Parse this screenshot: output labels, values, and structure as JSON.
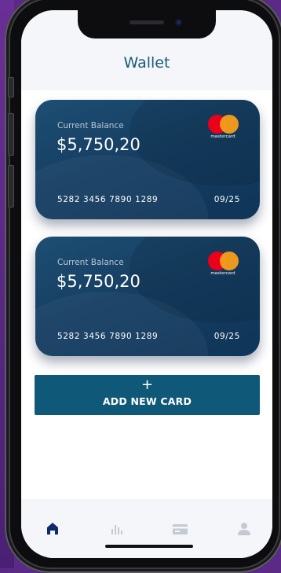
{
  "header": {
    "title": "Wallet"
  },
  "cards": [
    {
      "balance_label": "Current Balance",
      "balance": "$5,750,20",
      "number": "5282 3456 7890 1289",
      "expiry": "09/25",
      "brand": "mastercard"
    },
    {
      "balance_label": "Current Balance",
      "balance": "$5,750,20",
      "number": "5282 3456 7890 1289",
      "expiry": "09/25",
      "brand": "mastercard"
    }
  ],
  "add_card": {
    "icon": "+",
    "label": "ADD NEW CARD"
  },
  "tabbar": {
    "items": [
      {
        "icon": "home-icon",
        "active": true
      },
      {
        "icon": "stats-icon",
        "active": false
      },
      {
        "icon": "card-icon",
        "active": false
      },
      {
        "icon": "profile-icon",
        "active": false
      }
    ]
  },
  "colors": {
    "primary": "#0f5878",
    "card_bg": "#163f63",
    "active_tab": "#0f2a6b",
    "inactive_tab": "#c4cad4"
  }
}
